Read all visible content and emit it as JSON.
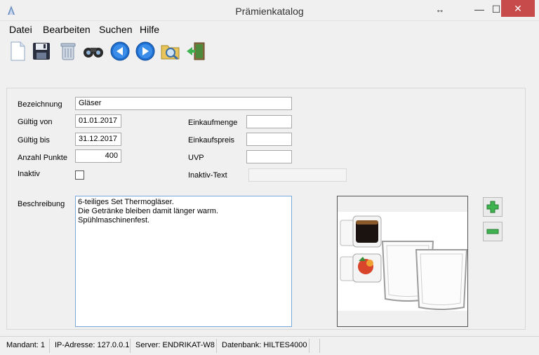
{
  "window": {
    "title": "Prämienkatalog",
    "close_glyph": "✕",
    "max_glyph": "☐",
    "min_glyph": "—",
    "resize_glyph": "↔"
  },
  "menu": {
    "items": [
      "Datei",
      "Bearbeiten",
      "Suchen",
      "Hilfe"
    ]
  },
  "toolbar": {
    "icons": [
      "new-document-icon",
      "save-icon",
      "delete-icon",
      "search-binoculars-icon",
      "previous-record-icon",
      "next-record-icon",
      "find-icon",
      "exit-icon"
    ]
  },
  "form": {
    "bezeichnung_label": "Bezeichnung",
    "bezeichnung_value": "Gläser",
    "gueltig_von_label": "Gültig von",
    "gueltig_von_value": "01.01.2017",
    "gueltig_bis_label": "Gültig bis",
    "gueltig_bis_value": "31.12.2017",
    "anzahl_punkte_label": "Anzahl Punkte",
    "anzahl_punkte_value": "400",
    "inaktiv_label": "Inaktiv",
    "inaktiv_checked": false,
    "einkaufmenge_label": "Einkaufmenge",
    "einkaufmenge_value": "",
    "einkaufspreis_label": "Einkaufspreis",
    "einkaufspreis_value": "",
    "uvp_label": "UVP",
    "uvp_value": "",
    "inaktiv_text_label": "Inaktiv-Text",
    "inaktiv_text_value": "",
    "beschreibung_label": "Beschreibung",
    "beschreibung_value": "6-teiliges Set Thermogläser.\nDie Getränke bleiben damit länger warm.\nSpühlmaschinenfest."
  },
  "buttons": {
    "add_icon": "plus-icon",
    "remove_icon": "minus-icon"
  },
  "status": {
    "mandant": "Mandant: 1",
    "ip": "IP-Adresse: 127.0.0.1",
    "server": "Server: ENDRIKAT-W8",
    "datenbank": "Datenbank: HILTES4000"
  },
  "colors": {
    "close_button": "#c74b4b",
    "accent_green": "#3fb34f",
    "nav_blue": "#1e6fd0"
  }
}
